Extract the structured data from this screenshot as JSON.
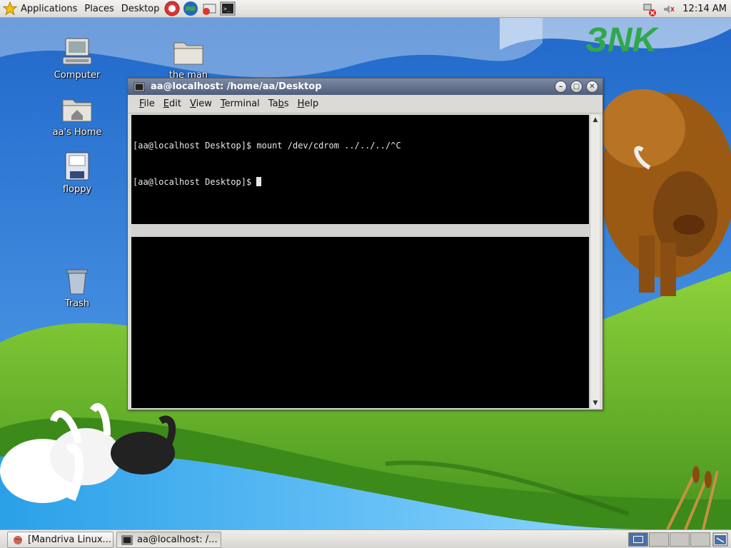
{
  "top_panel": {
    "menus": [
      "Applications",
      "Places",
      "Desktop"
    ],
    "launchers": [
      "help-icon",
      "web-browser-icon",
      "mail-icon",
      "terminal-icon"
    ],
    "clock": "12:14 AM"
  },
  "wallpaper": {
    "logo_text": "ЗNK"
  },
  "desktop_icons": [
    {
      "label": "Computer",
      "icon": "computer-icon"
    },
    {
      "label": "the man",
      "icon": "folder-icon"
    },
    {
      "label": "aa's Home",
      "icon": "home-folder-icon"
    },
    {
      "label": "floppy",
      "icon": "floppy-icon"
    },
    {
      "label": "Trash",
      "icon": "trash-icon"
    }
  ],
  "terminal": {
    "title": "aa@localhost: /home/aa/Desktop",
    "menus": [
      {
        "label": "File",
        "mnemonic": "F"
      },
      {
        "label": "Edit",
        "mnemonic": "E"
      },
      {
        "label": "View",
        "mnemonic": "V"
      },
      {
        "label": "Terminal",
        "mnemonic": "T"
      },
      {
        "label": "Tabs",
        "mnemonic": "b"
      },
      {
        "label": "Help",
        "mnemonic": "H"
      }
    ],
    "lines": [
      "[aa@localhost Desktop]$ mount /dev/cdrom ../../../^C",
      "[aa@localhost Desktop]$ "
    ]
  },
  "taskbar": {
    "tasks": [
      {
        "label": "[Mandriva Linux...",
        "active": false
      },
      {
        "label": "aa@localhost: /...",
        "active": true
      }
    ],
    "workspaces": 4,
    "active_workspace": 1
  },
  "colors": {
    "titlebar": "#5a6886",
    "terminal_bg": "#000000",
    "terminal_fg": "#e6e6e6"
  }
}
